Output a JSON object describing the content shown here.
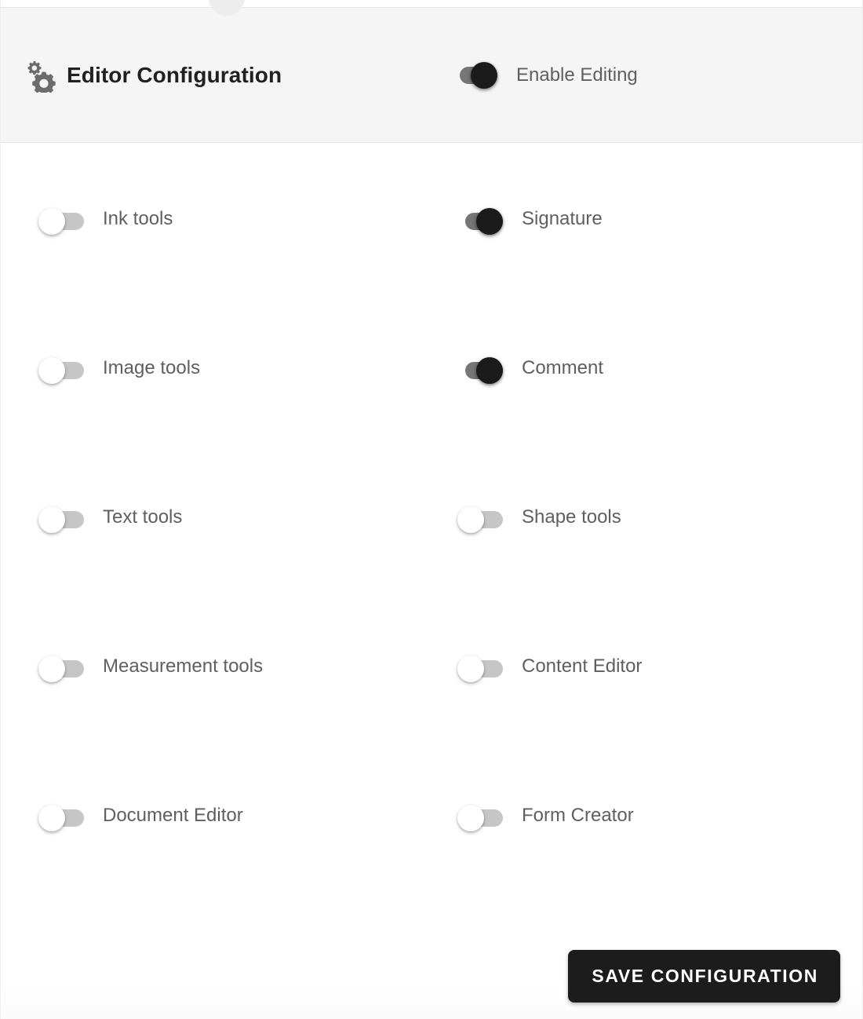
{
  "header": {
    "icon": "settings-gears-icon",
    "title": "Editor Configuration",
    "master_toggle": {
      "label": "Enable Editing",
      "state": "on"
    }
  },
  "options": [
    [
      {
        "label": "Ink tools",
        "state": "off"
      },
      {
        "label": "Signature",
        "state": "on"
      }
    ],
    [
      {
        "label": "Image tools",
        "state": "off"
      },
      {
        "label": "Comment",
        "state": "on"
      }
    ],
    [
      {
        "label": "Text tools",
        "state": "off"
      },
      {
        "label": "Shape tools",
        "state": "off"
      }
    ],
    [
      {
        "label": "Measurement tools",
        "state": "off"
      },
      {
        "label": "Content Editor",
        "state": "off"
      }
    ],
    [
      {
        "label": "Document Editor",
        "state": "off"
      },
      {
        "label": "Form Creator",
        "state": "off"
      }
    ]
  ],
  "footer": {
    "save_label": "SAVE CONFIGURATION"
  },
  "colors": {
    "header_background": "#f5f5f5",
    "body_background": "#ffffff",
    "title_text": "#212121",
    "label_text": "#5f5f5f",
    "toggle_on_track": "#767676",
    "toggle_on_knob": "#1b1b1b",
    "toggle_off_track": "#c6c6c6",
    "toggle_off_knob": "#ffffff",
    "button_background": "#1c1c1c",
    "button_text": "#ffffff"
  }
}
